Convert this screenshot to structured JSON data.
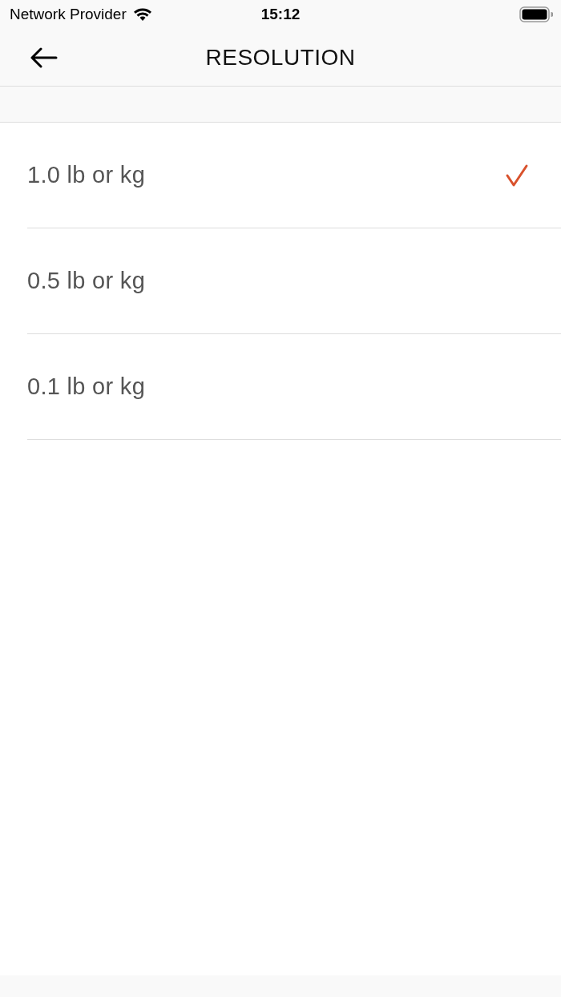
{
  "status_bar": {
    "carrier": "Network Provider",
    "time": "15:12"
  },
  "nav_bar": {
    "title": "RESOLUTION"
  },
  "options": [
    {
      "label": "1.0 lb or kg",
      "selected": true
    },
    {
      "label": "0.5 lb or kg",
      "selected": false
    },
    {
      "label": "0.1 lb or kg",
      "selected": false
    }
  ]
}
